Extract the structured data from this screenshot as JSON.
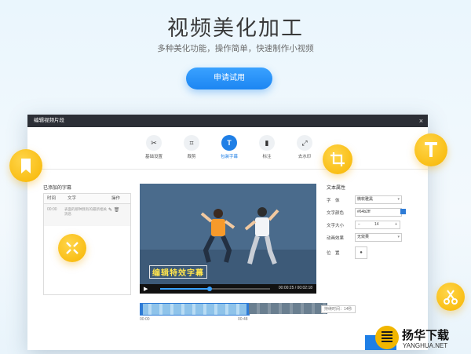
{
  "hero": {
    "title": "视频美化加工",
    "subtitle": "多种美化功能，操作简单，快速制作小视频",
    "apply_label": "申请试用"
  },
  "dialog": {
    "title": "编辑视频片段",
    "close": "×",
    "tabs": [
      {
        "label": "基础设置",
        "icon": "scissors-icon"
      },
      {
        "label": "裁剪",
        "icon": "crop-icon"
      },
      {
        "label": "包装字幕",
        "icon": "text-icon",
        "active": true
      },
      {
        "label": "标注",
        "icon": "bookmark-icon"
      },
      {
        "label": "去水印",
        "icon": "expand-icon"
      }
    ],
    "subtitles": {
      "title": "已添加的字幕",
      "columns": [
        "时间",
        "文字",
        "操作"
      ],
      "row": {
        "time": "00:00",
        "text": "表面的那种我有的最新相关消息"
      }
    },
    "video": {
      "caption": "编辑特效字幕",
      "time": "00:00:25 / 00:02:18",
      "progress": 0.45
    },
    "props": {
      "title": "文本属性",
      "font_label": "字　体",
      "font_value": "微软雅黑",
      "color_label": "文字颜色",
      "color_value": "#64b2ff",
      "size_label": "文字大小",
      "size_value": "14",
      "size_minus": "−",
      "size_plus": "+",
      "anim_label": "动画效果",
      "anim_value": "无效果",
      "pos_label": "位　置",
      "pos_icon": "●"
    },
    "timeline": {
      "start": "00:00",
      "mid": "00:48",
      "duration": "持续时间：14秒"
    }
  },
  "floating": [
    "bookmark-icon",
    "crop-icon",
    "text-icon",
    "expand-icon",
    "scissors-icon"
  ],
  "watermark": {
    "cn": "扬华下载",
    "en": "YANGHUA.NET"
  },
  "colors": {
    "accent": "#1f7fe6",
    "badge": "#f7b500"
  }
}
